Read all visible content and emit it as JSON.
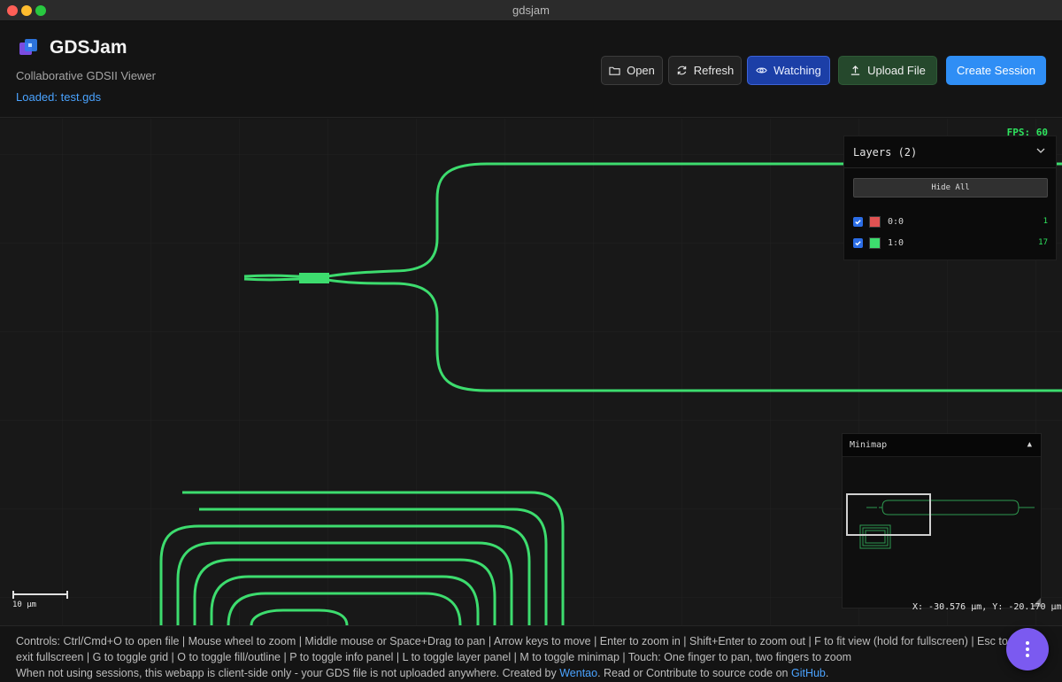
{
  "window": {
    "title": "gdsjam"
  },
  "header": {
    "app_name": "GDSJam",
    "subtitle": "Collaborative GDSII Viewer",
    "loaded": "Loaded: test.gds",
    "buttons": {
      "open": "Open",
      "refresh": "Refresh",
      "watching": "Watching",
      "upload": "Upload File",
      "create_session": "Create Session"
    }
  },
  "canvas": {
    "fps": "FPS: 60",
    "scale_label": "10 µm",
    "coords": "X: -30.576 µm, Y: -20.170 µm"
  },
  "layers_panel": {
    "title": "Layers (2)",
    "hide_all": "Hide All",
    "layers": [
      {
        "name": "0:0",
        "count": "1",
        "color": "#e05252",
        "visible": true
      },
      {
        "name": "1:0",
        "count": "17",
        "color": "#3ddc6e",
        "visible": true
      }
    ]
  },
  "minimap": {
    "title": "Minimap",
    "toggle": "▲"
  },
  "footer": {
    "controls": "Controls: Ctrl/Cmd+O to open file | Mouse wheel to zoom | Middle mouse or Space+Drag to pan | Arrow keys to move | Enter to zoom in | Shift+Enter to zoom out | F to fit view (hold for fullscreen) | Esc to exit fullscreen | G to toggle grid | O to toggle fill/outline | P to toggle info panel | L to toggle layer panel | M to toggle minimap | Touch: One finger to pan, two fingers to zoom",
    "note_pre": "When not using sessions, this webapp is client-side only - your GDS file is not uploaded anywhere. Created by ",
    "author": "Wentao",
    "note_mid": ". Read or Contribute to source code on ",
    "github": "GitHub",
    "note_end": "."
  },
  "icons": {
    "open": "folder-icon",
    "refresh": "refresh-icon",
    "watching": "eye-icon",
    "upload": "upload-icon",
    "fab": "more-vertical-icon"
  },
  "colors": {
    "geometry": "#3ddc6e",
    "accent": "#2f8ef5",
    "watch": "#1c3fa7",
    "fab": "#7b5af0"
  }
}
